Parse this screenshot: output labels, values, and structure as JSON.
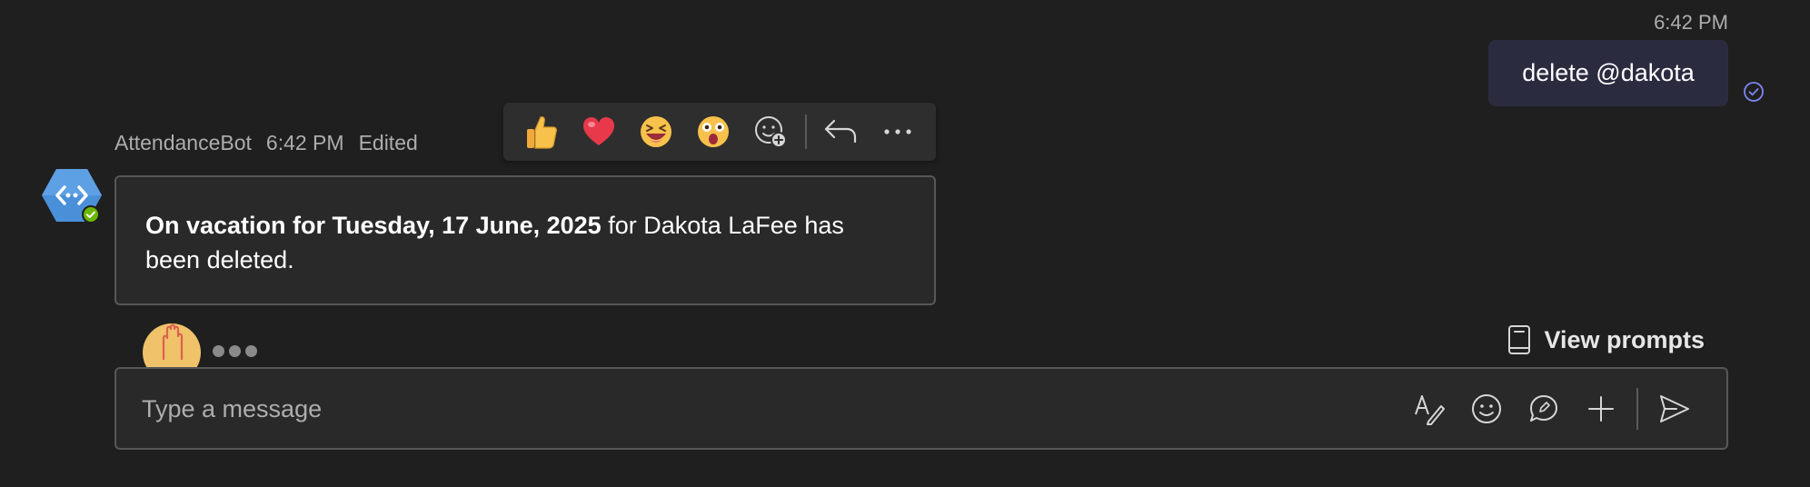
{
  "outgoing": {
    "time": "6:42 PM",
    "text": "delete @dakota"
  },
  "bot": {
    "name": "AttendanceBot",
    "time": "6:42 PM",
    "edited": "Edited",
    "message_bold": "On vacation for Tuesday, 17 June, 2025",
    "message_rest": " for Dakota LaFee has been deleted."
  },
  "reactions": [
    {
      "name": "like",
      "glyph": "👍"
    },
    {
      "name": "heart",
      "glyph": "❤️"
    },
    {
      "name": "laugh",
      "glyph": "😆"
    },
    {
      "name": "surprised",
      "glyph": "😲"
    }
  ],
  "view_prompts": "View prompts",
  "compose": {
    "placeholder": "Type a message"
  },
  "colors": {
    "background": "#1f1f1f",
    "outgoing_bubble": "#2b2b40",
    "card": "#292929",
    "accent": "#7f85f5",
    "bot_avatar": "#4a90d9",
    "online": "#6bb700"
  }
}
